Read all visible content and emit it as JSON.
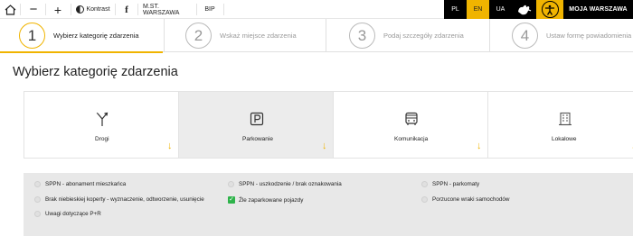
{
  "topbar": {
    "contrast_label": "Kontrast",
    "fb_label": "f",
    "city_label": "M.ST. WARSZAWA",
    "bip_label": "BIP",
    "languages": [
      "PL",
      "EN",
      "UA"
    ],
    "active_language": "EN",
    "account_label": "MOJA WARSZAWA",
    "accent_color": "#f0b400"
  },
  "steps": [
    {
      "number": "1",
      "label": "Wybierz kategorię zdarzenia",
      "active": true
    },
    {
      "number": "2",
      "label": "Wskaż miejsce zdarzenia",
      "active": false
    },
    {
      "number": "3",
      "label": "Podaj szczegóły zdarzenia",
      "active": false
    },
    {
      "number": "4",
      "label": "Ustaw formę powiadomienia",
      "active": false
    }
  ],
  "heading": "Wybierz kategorię zdarzenia",
  "categories": [
    {
      "label": "Drogi",
      "icon": "road-fork-icon",
      "selected": false
    },
    {
      "label": "Parkowanie",
      "icon": "parking-icon",
      "selected": true
    },
    {
      "label": "Komunikacja",
      "icon": "bus-icon",
      "selected": false
    },
    {
      "label": "Lokalowe",
      "icon": "building-icon",
      "selected": false
    }
  ],
  "subcategories": [
    {
      "label": "SPPN - abonament mieszkańca",
      "checked": false
    },
    {
      "label": "SPPN - uszkodzenie / brak oznakowania",
      "checked": false
    },
    {
      "label": "SPPN - parkomaty",
      "checked": false
    },
    {
      "label": "Brak niebieskiej koperty - wyznaczenie, odtworzenie, usunięcie",
      "checked": false
    },
    {
      "label": "Źle zaparkowane pojazdy",
      "checked": true
    },
    {
      "label": "Porzucone wraki samochodów",
      "checked": false
    },
    {
      "label": "Uwagi dotyczące P+R",
      "checked": false
    }
  ]
}
